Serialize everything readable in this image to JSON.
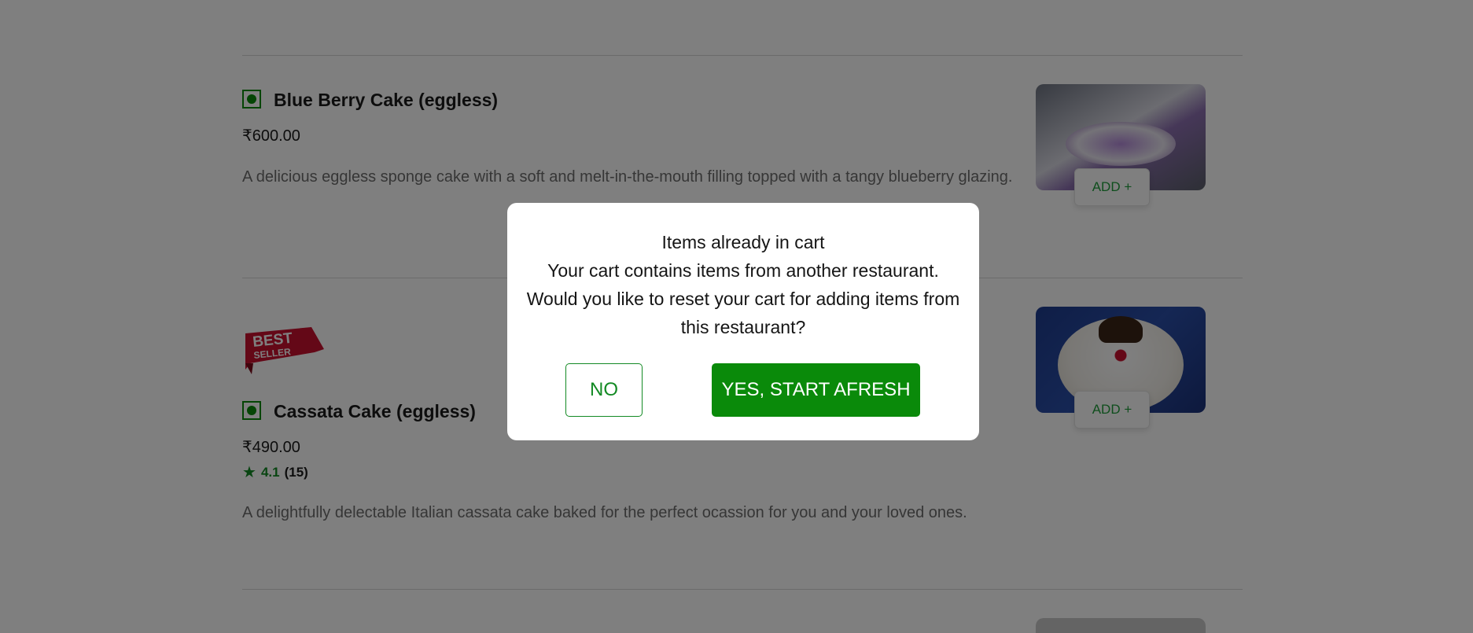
{
  "menu": {
    "items": [
      {
        "name": "Blue Berry Cake (eggless)",
        "price": "₹600.00",
        "description": "A delicious eggless sponge cake with a soft and melt-in-the-mouth filling topped with a tangy blueberry glazing.",
        "add_label": "ADD +",
        "veg": true
      },
      {
        "badge_line1": "BEST",
        "badge_line2": "SELLER",
        "name": "Cassata Cake (eggless)",
        "price": "₹490.00",
        "rating": "4.1",
        "rating_count": "(15)",
        "description": "A delightfully delectable Italian cassata cake baked for the perfect ocassion for you and your loved ones.",
        "add_label": "ADD +",
        "veg": true
      }
    ]
  },
  "modal": {
    "title": "Items already in cart",
    "body": "Your cart contains items from another restaurant. Would you like to reset your cart for adding items from this restaurant?",
    "no_label": "NO",
    "yes_label": "YES, START AFRESH"
  },
  "colors": {
    "accent_green": "#0a8a0a",
    "add_text_green": "#1f9d3a",
    "badge_red": "#c8102e",
    "overlay": "rgba(0,0,0,0.5)"
  }
}
